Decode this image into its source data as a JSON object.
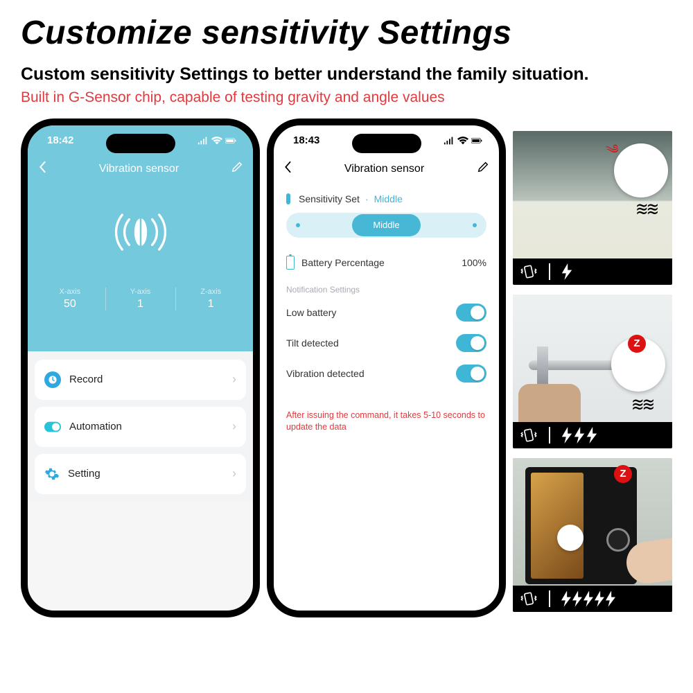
{
  "heading": "Customize sensitivity Settings",
  "subheading": "Custom sensitivity Settings to better understand the family situation.",
  "redline": "Built in G-Sensor chip, capable of testing gravity and angle values",
  "phone1": {
    "time": "18:42",
    "title": "Vibration sensor",
    "axes": {
      "x": {
        "label": "X-axis",
        "value": "50"
      },
      "y": {
        "label": "Y-axis",
        "value": "1"
      },
      "z": {
        "label": "Z-axis",
        "value": "1"
      }
    },
    "cards": {
      "record": "Record",
      "automation": "Automation",
      "setting": "Setting"
    }
  },
  "phone2": {
    "time": "18:43",
    "title": "Vibration sensor",
    "sensitivity": {
      "label": "Sensitivity Set",
      "value": "Middle",
      "pill": "Middle"
    },
    "battery": {
      "label": "Battery Percentage",
      "value": "100%"
    },
    "section": "Notification Settings",
    "toggles": {
      "low_battery": "Low battery",
      "tilt": "Tilt detected",
      "vibration": "Vibration detected"
    },
    "warn": "After issuing the command, it takes 5-10 seconds to update the data"
  },
  "thumbs": {
    "bolt_counts": [
      1,
      3,
      5
    ]
  }
}
